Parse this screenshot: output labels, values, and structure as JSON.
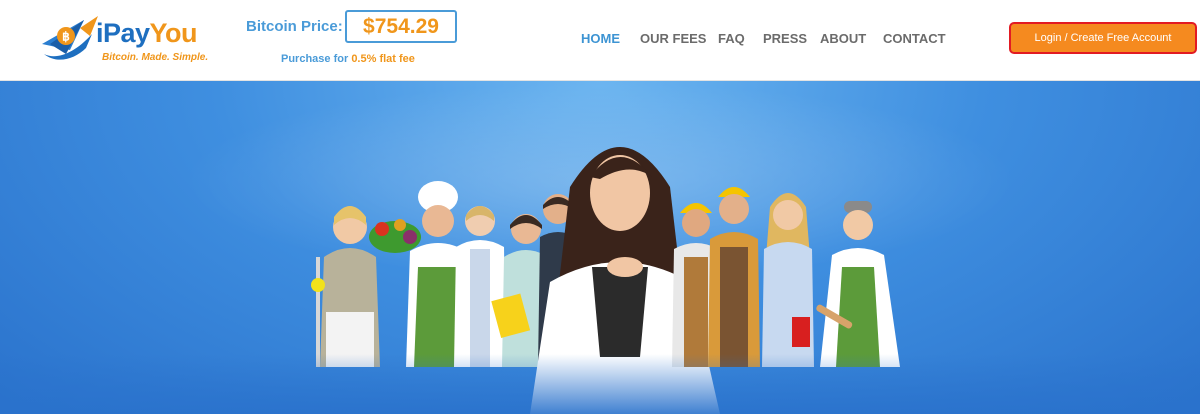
{
  "logo": {
    "name_part1": "iPay",
    "name_part2": "You",
    "tagline": "Bitcoin. Made. Simple."
  },
  "price": {
    "label": "Bitcoin Price:",
    "value": "$754.29",
    "fee_prefix": "Purchase for ",
    "fee_amount": "0.5% flat fee"
  },
  "nav": {
    "items": [
      {
        "label": "HOME",
        "active": true
      },
      {
        "label": "OUR FEES"
      },
      {
        "label": "FAQ"
      },
      {
        "label": "PRESS"
      },
      {
        "label": "ABOUT"
      },
      {
        "label": "CONTACT"
      }
    ]
  },
  "login": {
    "label": "Login / Create Free Account"
  },
  "colors": {
    "brand_blue": "#1e6fc0",
    "brand_orange": "#f0961b",
    "nav_active": "#3d94d3",
    "button_orange": "#f58a1f",
    "button_border": "#e21b23",
    "hero_blue": "#3f8fe0"
  },
  "hero": {
    "image_subject": "group-of-professionals-photo"
  }
}
